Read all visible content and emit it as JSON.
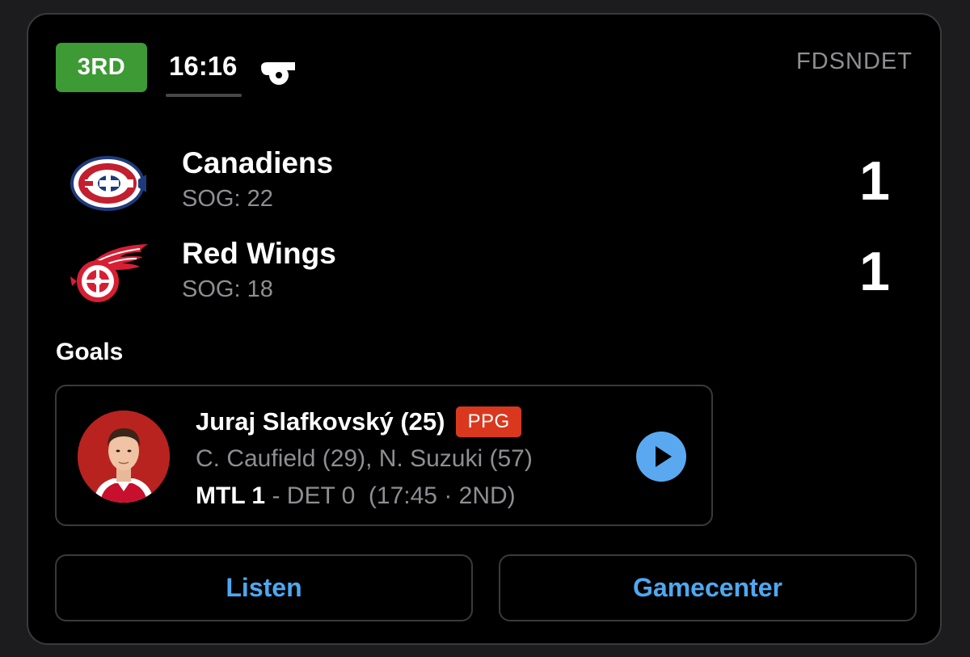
{
  "header": {
    "period": "3RD",
    "clock": "16:16",
    "network": "FDSNDET",
    "period_color": "#3d9a34"
  },
  "teams": [
    {
      "name": "Canadiens",
      "sog": "SOG: 22",
      "score": "1",
      "logo_icon": "canadiens-logo-icon"
    },
    {
      "name": "Red Wings",
      "sog": "SOG: 18",
      "score": "1",
      "logo_icon": "red-wings-logo-icon"
    }
  ],
  "goals": {
    "heading": "Goals",
    "items": [
      {
        "scorer": "Juraj Slafkovský (25)",
        "tag": "PPG",
        "assists": "C. Caufield (29), N. Suzuki (57)",
        "score_lead": "MTL 1",
        "score_rest": " - DET 0  (17:45 · 2ND)",
        "avatar_icon": "player-headshot"
      }
    ]
  },
  "actions": {
    "listen": "Listen",
    "gamecenter": "Gamecenter"
  },
  "colors": {
    "accent": "#4ea8f0",
    "tag": "#d9381e",
    "secondary_text": "#8e8e93"
  }
}
